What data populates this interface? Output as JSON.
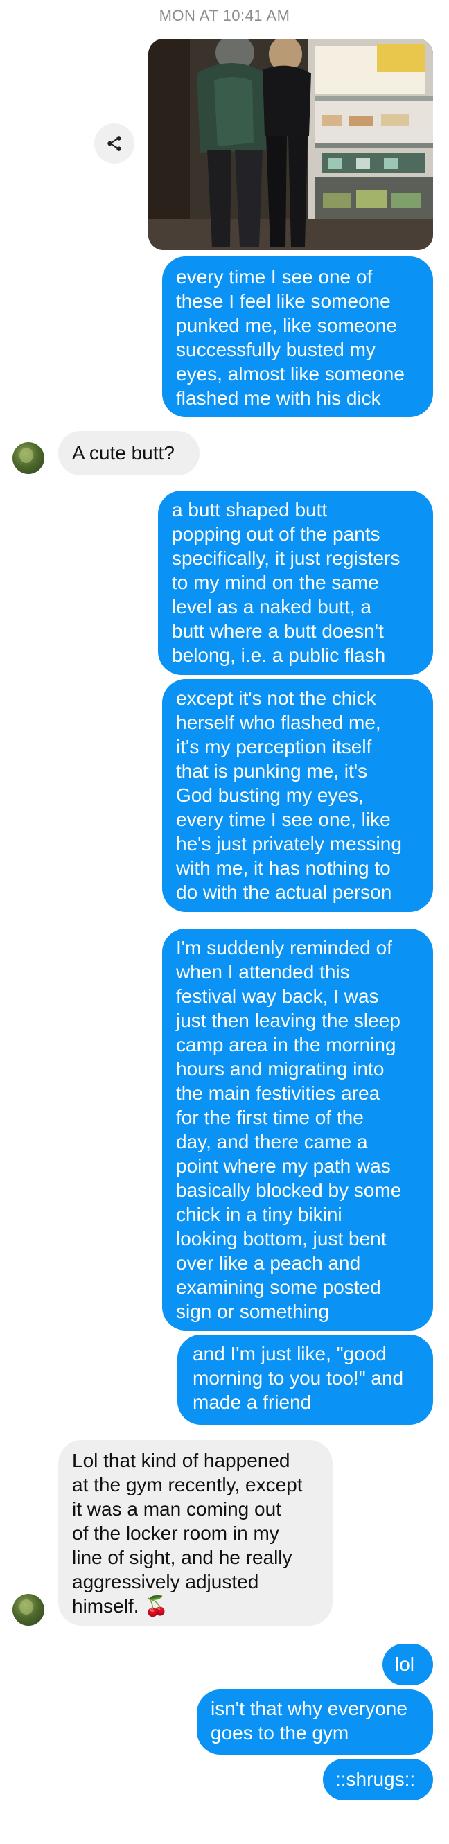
{
  "thread": {
    "timestamp": "MON AT 10:41 AM"
  },
  "colors": {
    "sent_bubble": "#0a93f5",
    "received_bubble": "#efefef",
    "timestamp_text": "#8c8c8c"
  },
  "icons": {
    "share": "share-icon",
    "avatar": "contact-avatar",
    "emoji": "cherries"
  },
  "messages": [
    {
      "sender": "me",
      "text": "every time I see one of\nthese I feel like someone\npunked me, like someone\nsuccessfully busted my\neyes, almost like someone\nflashed me with his dick"
    },
    {
      "sender": "them",
      "text": "A cute butt?"
    },
    {
      "sender": "me",
      "text": "a butt shaped butt\npopping out of the pants\nspecifically, it just registers\nto my mind on the same\nlevel as a naked butt, a\nbutt where a butt doesn't\nbelong, i.e. a public flash"
    },
    {
      "sender": "me",
      "text": "except it's not the chick\nherself who flashed me,\nit's my perception itself\nthat is punking me, it's\nGod busting my eyes,\nevery time I see one, like\nhe's just privately messing\nwith me, it has nothing to\ndo with the actual person"
    },
    {
      "sender": "me",
      "text": "I'm suddenly reminded of\nwhen I attended this\nfestival way back, I was\njust then leaving the sleep\ncamp area in the morning\nhours and migrating into\nthe main festivities area\nfor the first time of the\nday, and there came a\npoint where my path was\nbasically blocked by some\nchick in a tiny bikini\nlooking bottom, just bent\nover like a peach and\nexamining some posted\nsign or something"
    },
    {
      "sender": "me",
      "text": "and I'm just like, \"good\nmorning to you too!\" and\nmade a friend"
    },
    {
      "sender": "them",
      "text": "Lol that kind of happened\nat the gym recently, except\nit was a man coming out\nof the locker room in my\nline of sight, and he really\naggressively adjusted\nhimself. 🍒"
    },
    {
      "sender": "me",
      "text": "lol"
    },
    {
      "sender": "me",
      "text": "isn't that why everyone\ngoes to the gym"
    },
    {
      "sender": "me",
      "text": "::shrugs::"
    }
  ]
}
